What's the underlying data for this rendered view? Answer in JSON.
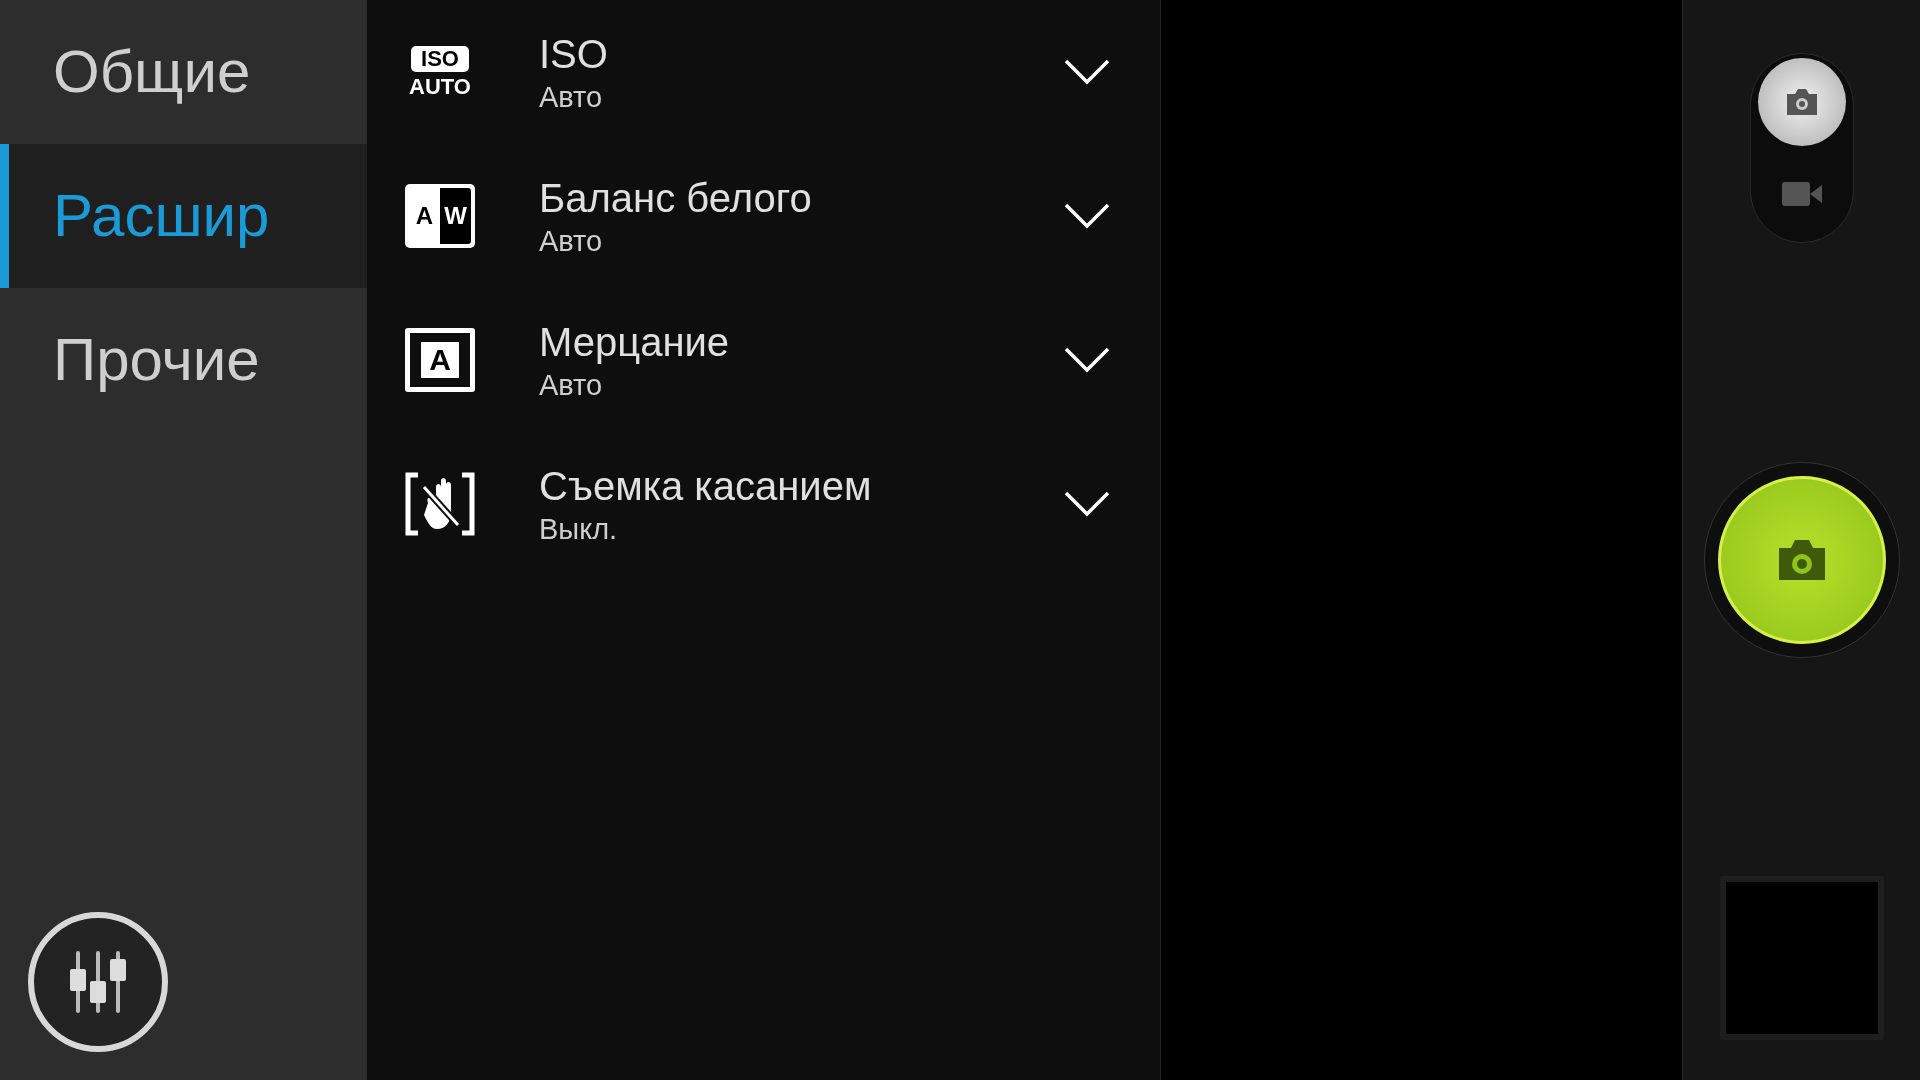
{
  "sidebar": {
    "tabs": [
      {
        "label": "Общие",
        "selected": false
      },
      {
        "label": "Расшир",
        "selected": true
      },
      {
        "label": "Прочие",
        "selected": false
      }
    ]
  },
  "camera_modes": [
    {
      "kind": "photo",
      "selected": true
    },
    {
      "kind": "video",
      "selected": false
    }
  ],
  "settings": [
    {
      "kind": "iso",
      "icon_texts": [
        "ISO",
        "AUTO"
      ],
      "title": "ISO",
      "value": "Авто"
    },
    {
      "kind": "wb",
      "icon_texts": [
        "A",
        "W"
      ],
      "title": "Баланс белого",
      "value": "Авто"
    },
    {
      "kind": "flicker",
      "icon_texts": [
        "A"
      ],
      "title": "Мерцание",
      "value": "Авто"
    },
    {
      "kind": "touch",
      "title": "Съемка касанием",
      "value": "Выкл."
    }
  ]
}
